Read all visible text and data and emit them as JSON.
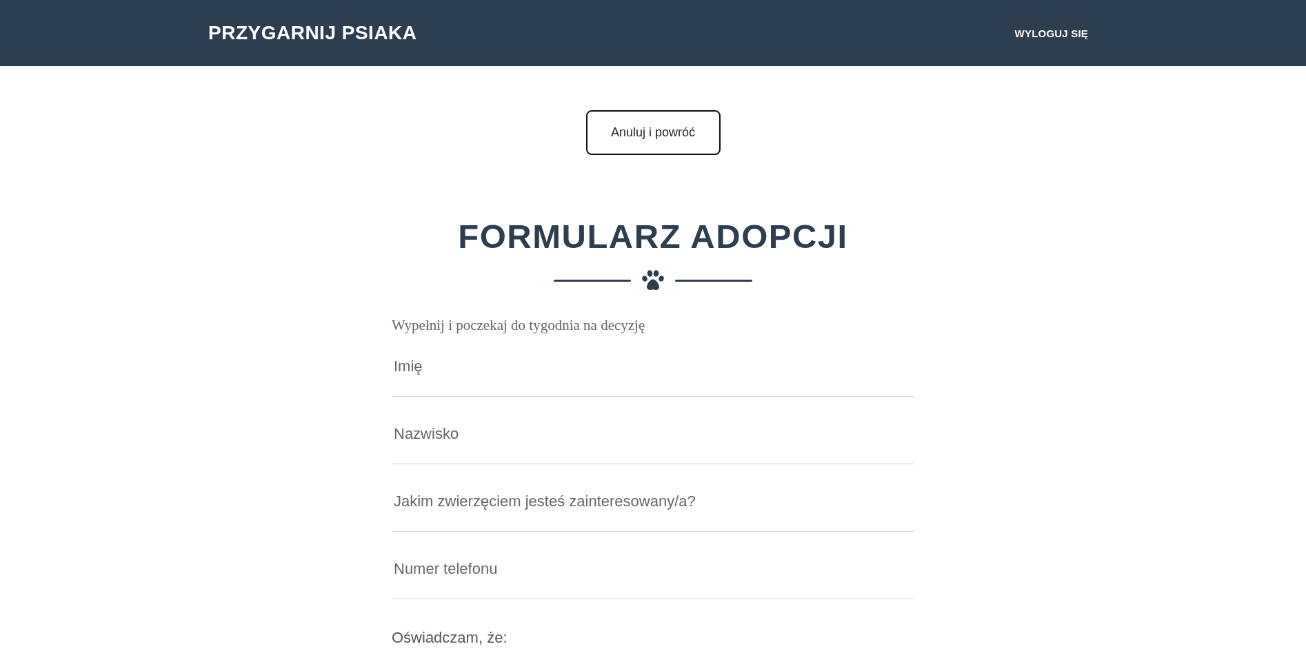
{
  "header": {
    "logo": "PRZYGARNIJ PSIAKA",
    "nav_links": [
      {
        "label": "WYLOGUJ SIĘ"
      }
    ]
  },
  "cancel_button": {
    "label": "Anuluj i powróć"
  },
  "form": {
    "title": "FORMULARZ ADOPCJI",
    "subtitle": "Wypełnij i poczekaj do tygodnia na decyzję",
    "fields": [
      {
        "placeholder": "Imię"
      },
      {
        "placeholder": "Nazwisko"
      },
      {
        "placeholder": "Jakim zwierzęciem jesteś zainteresowany/a?"
      },
      {
        "placeholder": "Numer telefonu"
      }
    ],
    "declaration_label": "Oświadczam, że:"
  }
}
